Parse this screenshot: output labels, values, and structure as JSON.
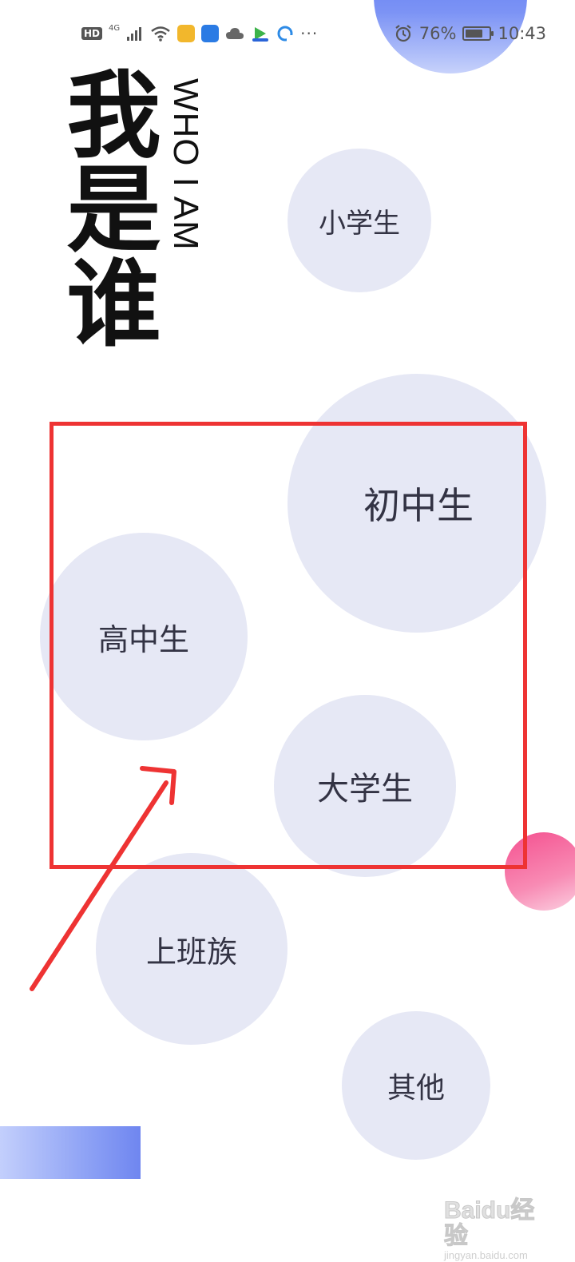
{
  "status_bar": {
    "hd": "HD",
    "network_type": "4G",
    "more": "···",
    "battery_percent": "76%",
    "battery_level": 0.76,
    "time": "10:43",
    "icons": [
      "signal-icon",
      "wifi-icon",
      "app-icon-1",
      "shield-app-icon",
      "cloud-icon",
      "video-app-icon",
      "browser-app-icon",
      "alarm-icon",
      "battery-icon"
    ]
  },
  "title": {
    "cn": "我是谁",
    "en": "WHO I AM"
  },
  "options": {
    "primary": "小学生",
    "junior": "初中生",
    "senior": "高中生",
    "college": "大学生",
    "worker": "上班族",
    "other": "其他"
  },
  "annotation": {
    "color": "#ee3333"
  },
  "colors": {
    "bubble": "#e6e8f5",
    "accent_blue": "#4a6ef2",
    "accent_pink": "#f4508f"
  },
  "watermark": {
    "logo": "Baidu经验",
    "url": "jingyan.baidu.com"
  }
}
